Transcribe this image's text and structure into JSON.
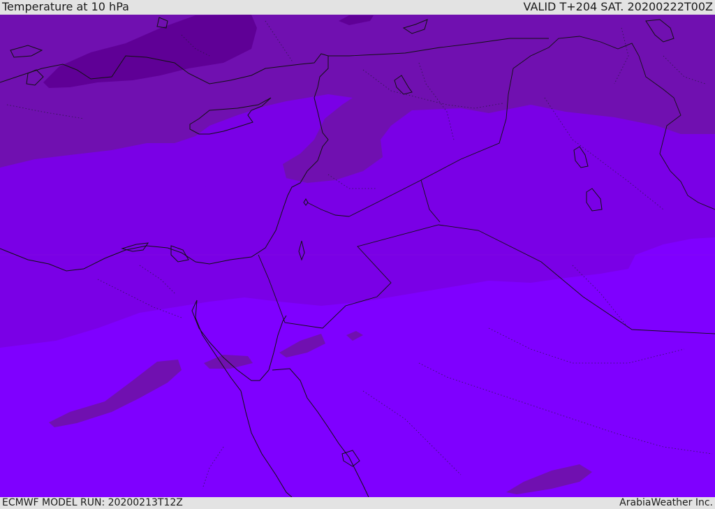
{
  "header": {
    "title": "Temperature at 10 hPa",
    "valid": "VALID T+204 SAT. 20200222T00Z"
  },
  "footer": {
    "model_run": "ECMWF MODEL RUN: 20200213T12Z",
    "credit": "ArabiaWeather Inc."
  },
  "map": {
    "colors": {
      "darkest": "#5f0096",
      "dark": "#7010b0",
      "mid": "#7a00e6",
      "light": "#7f00ff",
      "coast": "#1a1a2e"
    }
  }
}
